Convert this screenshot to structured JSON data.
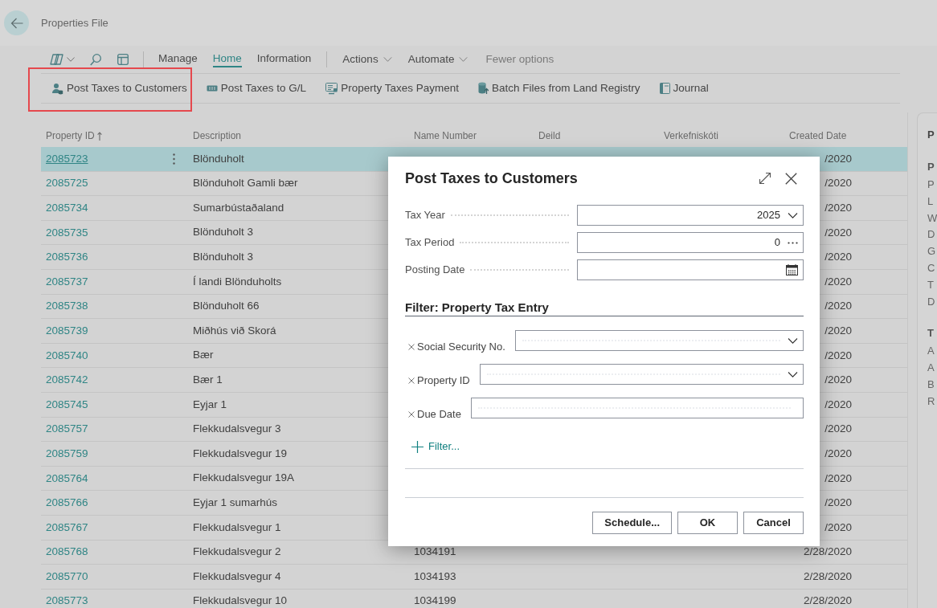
{
  "header": {
    "title": "Properties File"
  },
  "action_bar": {
    "tabs": [
      {
        "label": "Manage",
        "selected": false
      },
      {
        "label": "Home",
        "selected": true
      },
      {
        "label": "Information",
        "selected": false
      }
    ],
    "menus": [
      {
        "label": "Actions"
      },
      {
        "label": "Automate"
      }
    ],
    "fewer_options": "Fewer options"
  },
  "actions": [
    {
      "label": "Post Taxes to Customers",
      "highlighted": true
    },
    {
      "label": "Post Taxes to G/L",
      "highlighted": false
    },
    {
      "label": "Property Taxes Payment",
      "highlighted": false
    },
    {
      "label": "Batch Files from Land Registry",
      "highlighted": false
    },
    {
      "label": "Journal",
      "highlighted": false
    }
  ],
  "table": {
    "columns": [
      {
        "label": "Property ID",
        "sorted_ascending": true
      },
      {
        "label": "Description"
      },
      {
        "label": "Name Number"
      },
      {
        "label": "Deild"
      },
      {
        "label": "Verkefniskóti"
      },
      {
        "label": "Created Date"
      }
    ],
    "rows": [
      {
        "property_id": "2085723",
        "description": "Blönduholt",
        "created_date": "/2020",
        "selected": true
      },
      {
        "property_id": "2085725",
        "description": "Blönduholt Gamli bær",
        "created_date": "/2020",
        "selected": false
      },
      {
        "property_id": "2085734",
        "description": "Sumarbústaðaland",
        "created_date": "/2020",
        "selected": false
      },
      {
        "property_id": "2085735",
        "description": "Blönduholt 3",
        "created_date": "/2020",
        "selected": false
      },
      {
        "property_id": "2085736",
        "description": "Blönduholt 3",
        "created_date": "/2020",
        "selected": false
      },
      {
        "property_id": "2085737",
        "description": "Í landi Blönduholts",
        "created_date": "/2020",
        "selected": false
      },
      {
        "property_id": "2085738",
        "description": "Blönduholt 66",
        "created_date": "/2020",
        "selected": false
      },
      {
        "property_id": "2085739",
        "description": "Miðhús við Skorá",
        "created_date": "/2020",
        "selected": false
      },
      {
        "property_id": "2085740",
        "description": "Bær",
        "created_date": "/2020",
        "selected": false
      },
      {
        "property_id": "2085742",
        "description": "Bær 1",
        "created_date": "/2020",
        "selected": false
      },
      {
        "property_id": "2085745",
        "description": "Eyjar 1",
        "created_date": "/2020",
        "selected": false
      },
      {
        "property_id": "2085757",
        "description": "Flekkudalsvegur 3",
        "created_date": "/2020",
        "selected": false
      },
      {
        "property_id": "2085759",
        "description": "Flekkudalsvegur 19",
        "created_date": "/2020",
        "selected": false
      },
      {
        "property_id": "2085764",
        "description": "Flekkudalsvegur 19A",
        "created_date": "/2020",
        "selected": false
      },
      {
        "property_id": "2085766",
        "description": "Eyjar 1 sumarhús",
        "created_date": "/2020",
        "selected": false
      },
      {
        "property_id": "2085767",
        "description": "Flekkudalsvegur 1",
        "created_date": "/2020",
        "selected": false
      },
      {
        "property_id": "2085768",
        "description": "Flekkudalsvegur 2",
        "name_number": "1034191",
        "created_date": "2/28/2020",
        "selected": false
      },
      {
        "property_id": "2085770",
        "description": "Flekkudalsvegur 4",
        "name_number": "1034193",
        "created_date": "2/28/2020",
        "selected": false
      },
      {
        "property_id": "2085773",
        "description": "Flekkudalsvegur 10",
        "name_number": "1034199",
        "created_date": "2/28/2020",
        "selected": false
      }
    ]
  },
  "factbox": {
    "title": "P",
    "sections": [
      {
        "heading": "P",
        "items": [
          "P",
          "L",
          "W",
          "D",
          "G",
          "C",
          "T",
          "D"
        ]
      },
      {
        "heading": "T",
        "items": [
          "A",
          "A",
          "B",
          "R"
        ]
      }
    ]
  },
  "dialog": {
    "title": "Post Taxes to Customers",
    "fields": [
      {
        "label": "Tax Year",
        "value": "2025",
        "kind": "dropdown"
      },
      {
        "label": "Tax Period",
        "value": "0",
        "kind": "lookup"
      },
      {
        "label": "Posting Date",
        "kind": "date"
      }
    ],
    "filter": {
      "heading": "Filter: Property Tax Entry",
      "fields": [
        {
          "label": "Social Security No.",
          "kind": "dropdown"
        },
        {
          "label": "Property ID",
          "kind": "dropdown"
        },
        {
          "label": "Due Date",
          "kind": "text"
        }
      ],
      "add_filter": "Filter..."
    },
    "buttons": [
      {
        "label": "Schedule..."
      },
      {
        "label": "OK"
      },
      {
        "label": "Cancel"
      }
    ]
  }
}
